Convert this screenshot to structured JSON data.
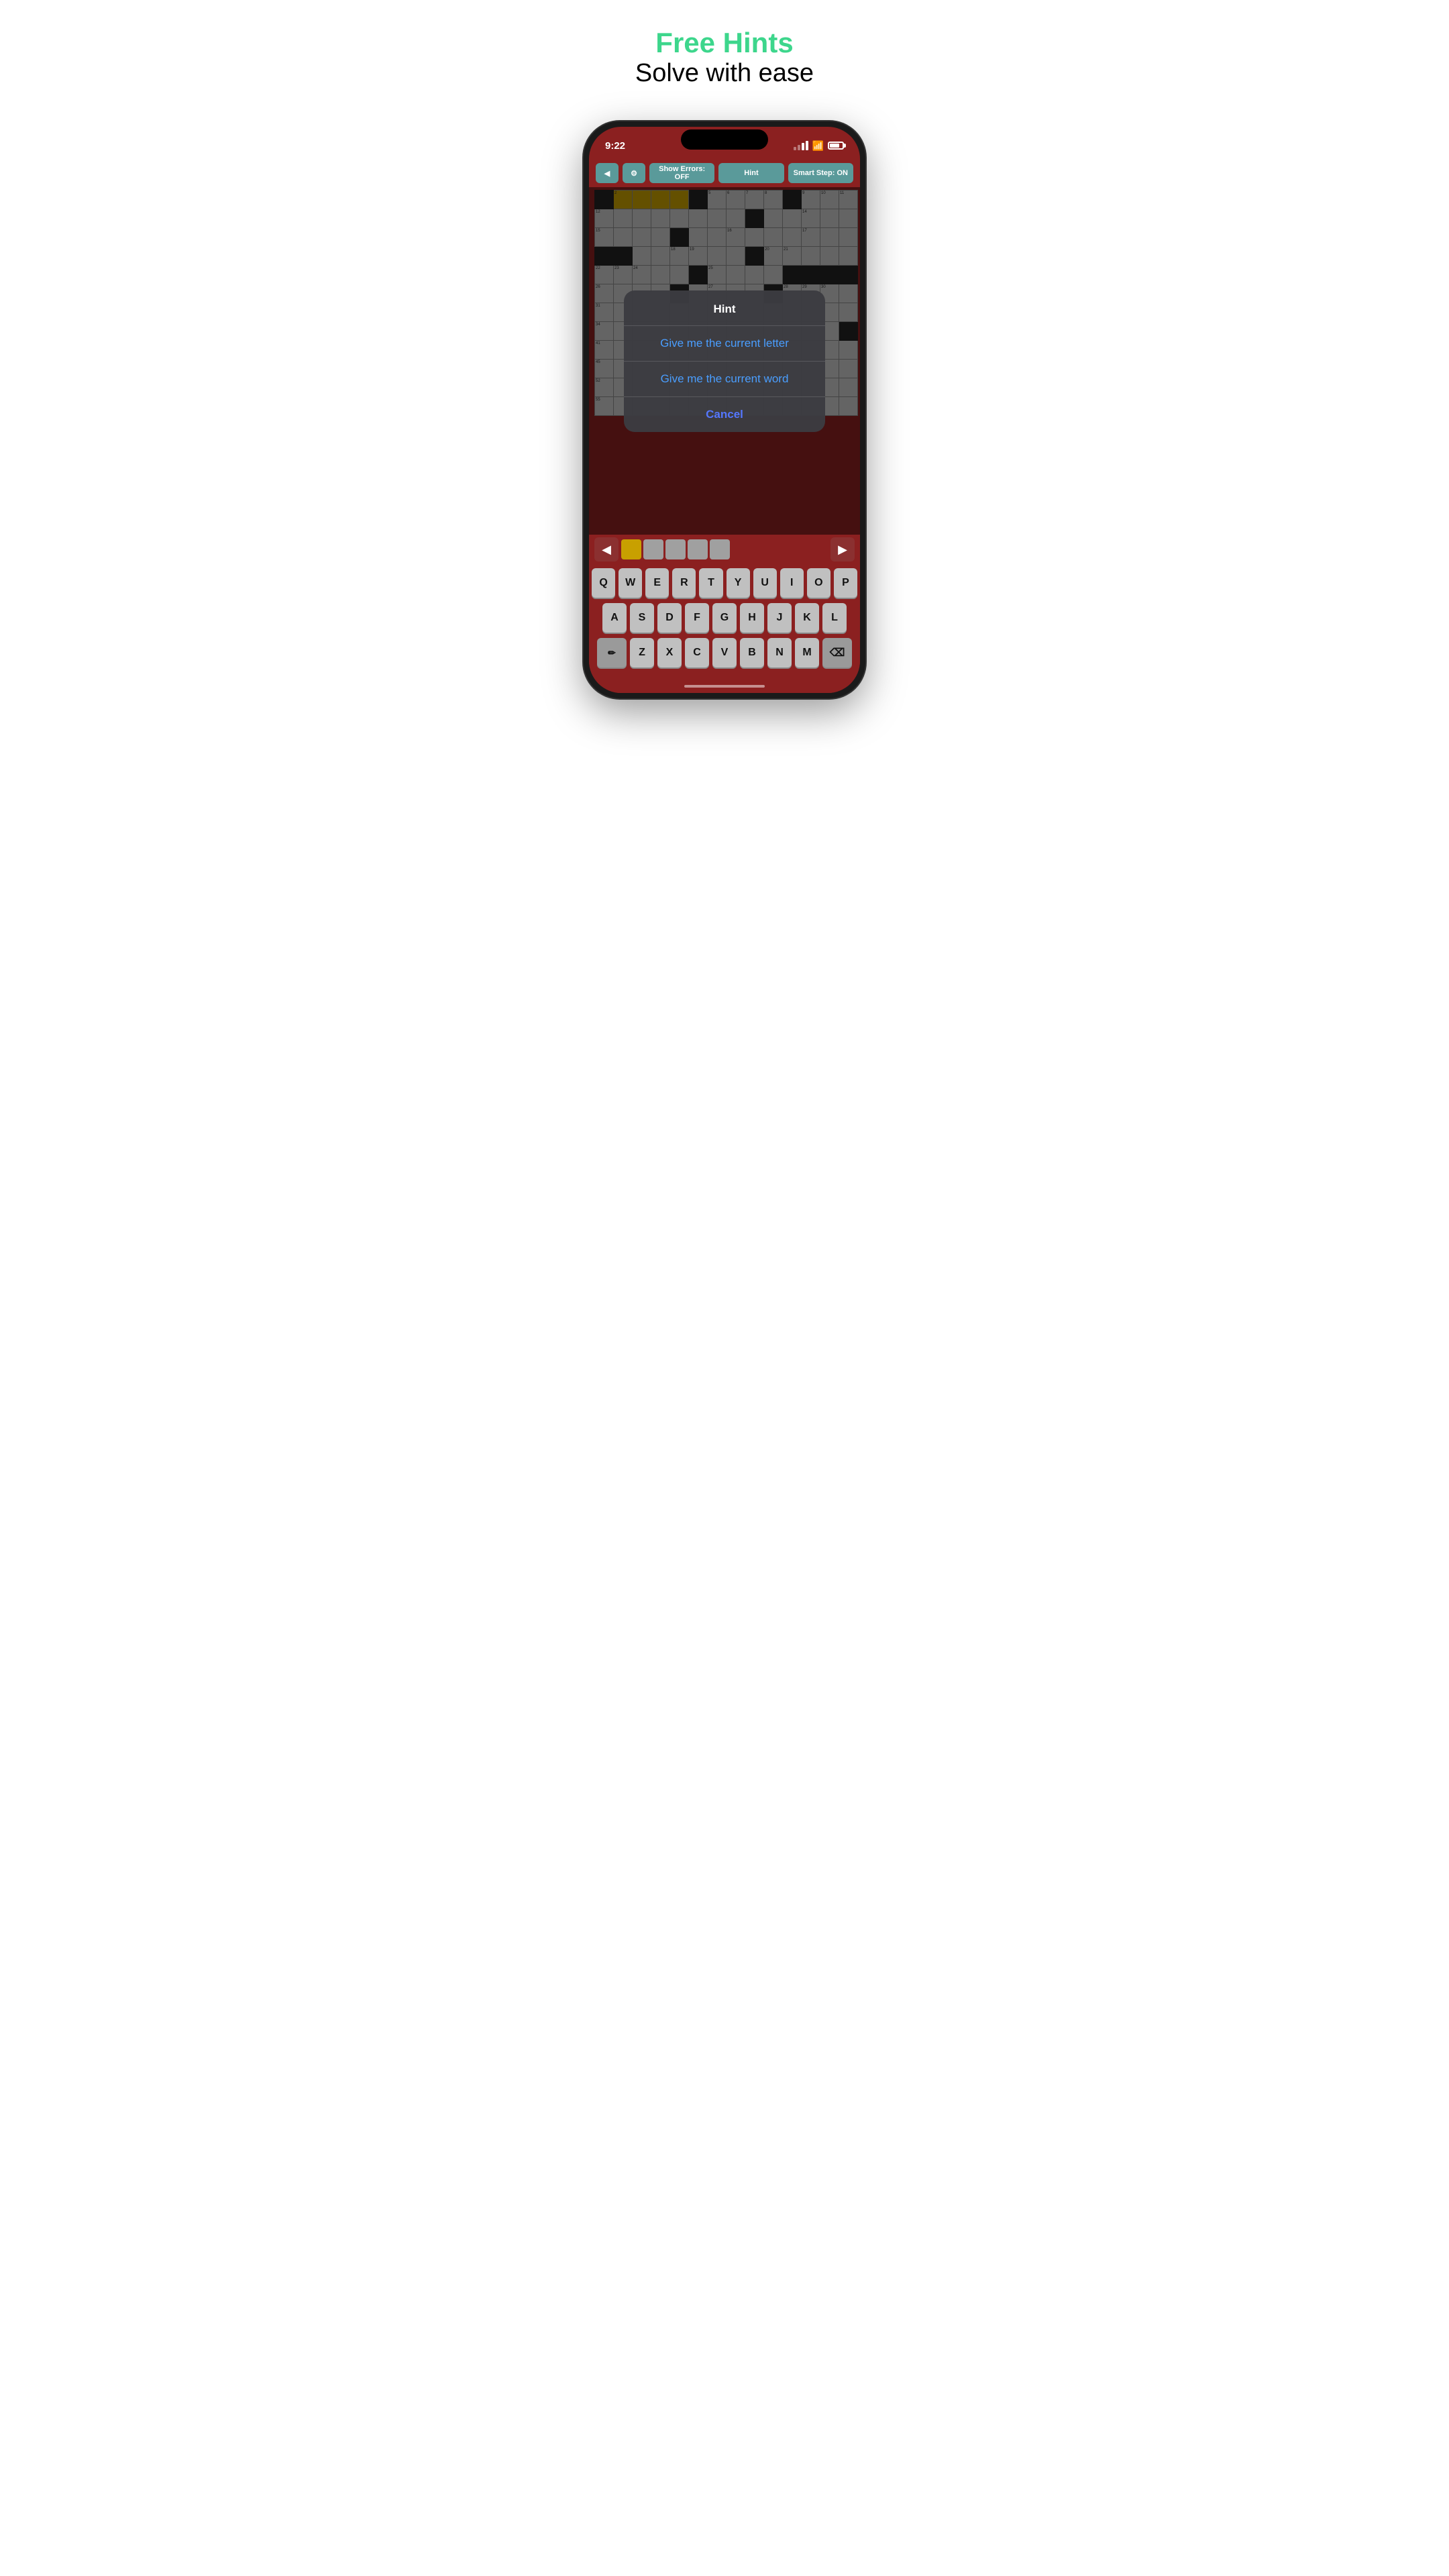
{
  "header": {
    "title_green": "Free Hints",
    "title_black": "Solve with ease"
  },
  "status_bar": {
    "time": "9:22"
  },
  "toolbar": {
    "back_label": "◀",
    "settings_label": "⚙",
    "show_errors_label": "Show Errors: OFF",
    "hint_label": "Hint",
    "smart_step_label": "Smart Step: ON"
  },
  "hint_dialog": {
    "title": "Hint",
    "option1": "Give me the current letter",
    "option2": "Give me the current word",
    "cancel": "Cancel"
  },
  "keyboard": {
    "row1": [
      "Q",
      "W",
      "E",
      "R",
      "T",
      "Y",
      "U",
      "I",
      "O",
      "P"
    ],
    "row2": [
      "A",
      "S",
      "D",
      "F",
      "G",
      "H",
      "J",
      "K",
      "L"
    ],
    "row3": [
      "Z",
      "X",
      "C",
      "V",
      "B",
      "N",
      "M"
    ]
  }
}
